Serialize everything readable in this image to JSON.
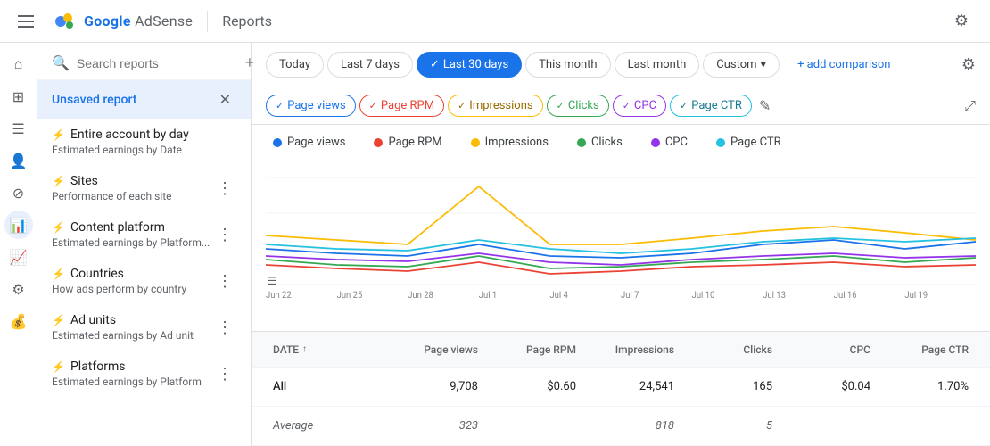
{
  "nav": {
    "app_name": "Google AdSense",
    "title": "Reports",
    "settings_tooltip": "Settings"
  },
  "date_filters": {
    "today": "Today",
    "last7": "Last 7 days",
    "last30": "Last 30 days",
    "thismonth": "This month",
    "lastmonth": "Last month",
    "custom": "Custom",
    "add_comparison": "+ add comparison",
    "active": "last30"
  },
  "metrics": {
    "chips": [
      {
        "id": "pageviews",
        "label": "Page views",
        "color": "#1a73e8",
        "cls": "chip-pageviews"
      },
      {
        "id": "pagerpm",
        "label": "Page RPM",
        "color": "#ea4335",
        "cls": "chip-pagerpm"
      },
      {
        "id": "impressions",
        "label": "Impressions",
        "color": "#fbbc04",
        "cls": "chip-impressions"
      },
      {
        "id": "clicks",
        "label": "Clicks",
        "color": "#34a853",
        "cls": "chip-clicks"
      },
      {
        "id": "cpc",
        "label": "CPC",
        "color": "#9334e8",
        "cls": "chip-cpc"
      },
      {
        "id": "pagectr",
        "label": "Page CTR",
        "color": "#24c1e0",
        "cls": "chip-pagectr"
      }
    ]
  },
  "legend": {
    "items": [
      {
        "label": "Page views",
        "color": "#1a73e8"
      },
      {
        "label": "Page RPM",
        "color": "#ea4335"
      },
      {
        "label": "Impressions",
        "color": "#fbbc04"
      },
      {
        "label": "Clicks",
        "color": "#34a853"
      },
      {
        "label": "CPC",
        "color": "#9334e8"
      },
      {
        "label": "Page CTR",
        "color": "#24c1e0"
      }
    ]
  },
  "chart": {
    "x_labels": [
      "Jun 22",
      "Jun 25",
      "Jun 28",
      "Jul 1",
      "Jul 4",
      "Jul 7",
      "Jul 10",
      "Jul 13",
      "Jul 16",
      "Jul 19"
    ],
    "filter_icon": "☰"
  },
  "reports_panel": {
    "search_placeholder": "Search reports",
    "unsaved_report": "Unsaved report",
    "reports": [
      {
        "name": "Entire account by day",
        "desc": "Estimated earnings by Date"
      },
      {
        "name": "Sites",
        "desc": "Performance of each site"
      },
      {
        "name": "Content platform",
        "desc": "Estimated earnings by Platform..."
      },
      {
        "name": "Countries",
        "desc": "How ads perform by country"
      },
      {
        "name": "Ad units",
        "desc": "Estimated earnings by Ad unit"
      },
      {
        "name": "Platforms",
        "desc": "Estimated earnings by Platform"
      }
    ]
  },
  "table": {
    "headers": {
      "date": "DATE",
      "pageviews": "Page views",
      "pagerpm": "Page RPM",
      "impressions": "Impressions",
      "clicks": "Clicks",
      "cpc": "CPC",
      "pagectr": "Page CTR"
    },
    "rows": [
      {
        "date": "All",
        "pageviews": "9,708",
        "pagerpm": "$0.60",
        "impressions": "24,541",
        "clicks": "165",
        "cpc": "$0.04",
        "pagectr": "1.70%"
      },
      {
        "date": "Average",
        "pageviews": "323",
        "pagerpm": "—",
        "impressions": "818",
        "clicks": "5",
        "cpc": "—",
        "pagectr": "—"
      }
    ]
  },
  "icons": {
    "home": "⌂",
    "pages": "▣",
    "content": "☰",
    "people": "👤",
    "block": "⊘",
    "reports": "📊",
    "trends": "📈",
    "settings": "⚙",
    "money": "💰",
    "gear": "⚙",
    "hamburger": "☰",
    "search": "🔍",
    "add": "+",
    "more": "⋮",
    "close": "✕",
    "check": "✓",
    "edit": "✎",
    "expand": "⤢",
    "down": "▾",
    "sort": "↑",
    "plus_blue": "+"
  }
}
